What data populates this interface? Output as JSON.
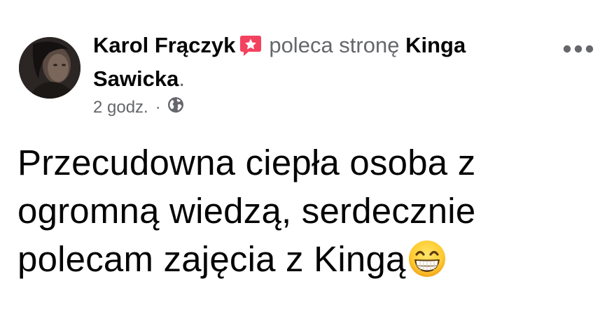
{
  "post": {
    "author": "Karol Frączyk",
    "recommends_text": "poleca stronę",
    "page_name": "Kinga Sawicka",
    "period": ".",
    "timestamp": "2 godz.",
    "separator": "·",
    "privacy_icon": "globe-icon",
    "recommend_icon": "recommendation-star-icon",
    "more_icon": "more-options-icon",
    "body_text": "Przecudowna ciepła osoba z ogromną wiedzą, serdecznie polecam zajęcia z Kingą",
    "emoji": "grinning-face-emoji"
  },
  "colors": {
    "primary_text": "#050505",
    "secondary_text": "#65676b",
    "recommend_red": "#f3425f",
    "background": "#ffffff"
  }
}
